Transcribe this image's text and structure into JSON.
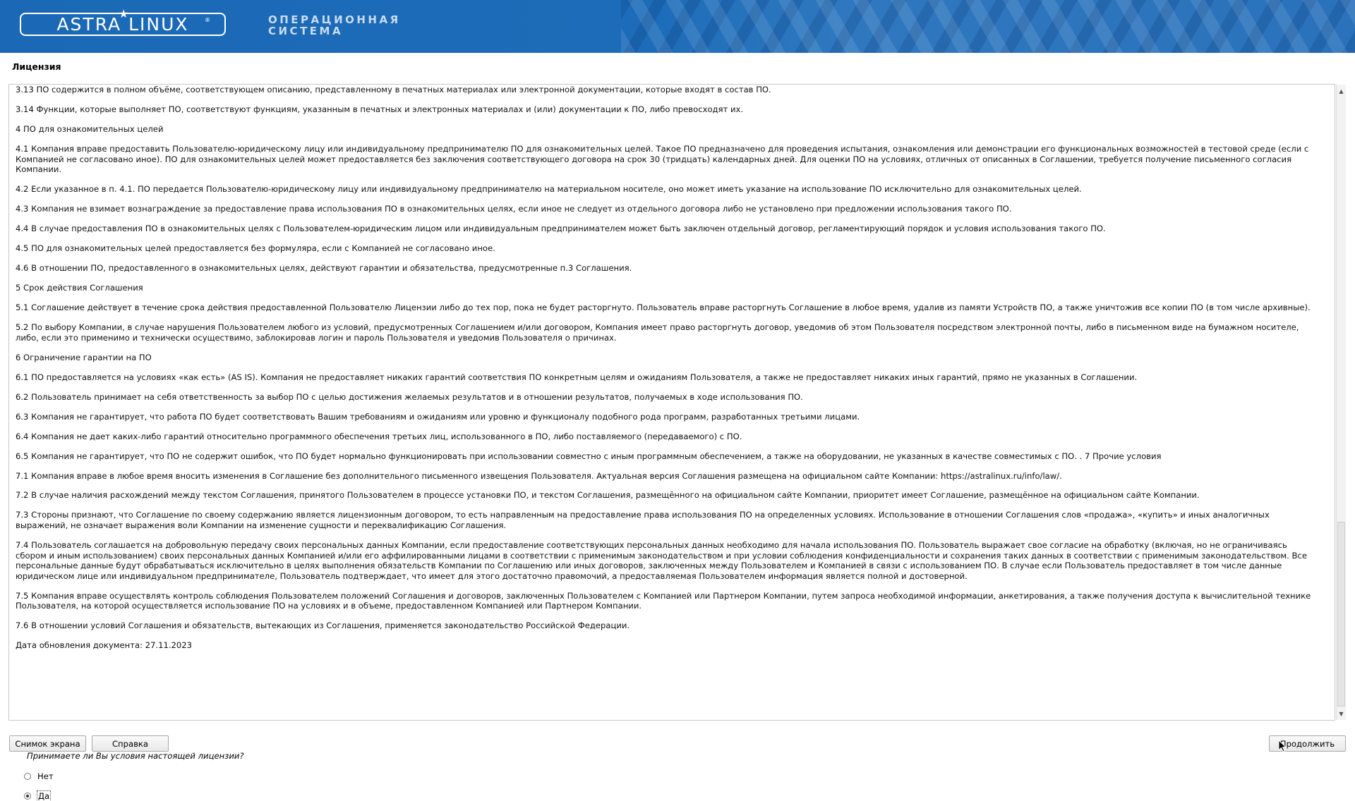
{
  "header": {
    "logo_text": "ASTRA LINUX",
    "logo_registered": "®",
    "subtitle_line1": "ОПЕРАЦИОННАЯ",
    "subtitle_line2": "СИСТЕМА",
    "colors": {
      "banner": "#1b69b6",
      "subtitle": "#c9dcf1"
    }
  },
  "section_title": "Лицензия",
  "license_paragraphs": [
    "3.13 ПО содержится в полном объёме, соответствующем описанию, представленному в печатных материалах или электронной документации, которые входят в состав ПО.",
    "3.14 Функции, которые выполняет ПО, соответствуют функциям, указанным в печатных и электронных материалах и (или) документации к ПО, либо превосходят их.",
    "4 ПО для ознакомительных целей",
    "4.1 Компания вправе предоставить Пользователю-юридическому лицу или индивидуальному предпринимателю ПО для ознакомительных целей. Такое ПО предназначено для проведения испытания, ознакомления или демонстрации его функциональных возможностей в тестовой среде (если с Компанией не согласовано иное). ПО для ознакомительных целей может предоставляется без заключения соответствующего договора на срок 30 (тридцать) календарных дней. Для оценки ПО на условиях, отличных от описанных в Соглашении, требуется получение письменного согласия Компании.",
    "4.2 Если указанное в п. 4.1. ПО передается Пользователю-юридическому лицу или индивидуальному предпринимателю на материальном носителе, оно может иметь указание на использование ПО исключительно для ознакомительных целей.",
    "4.3 Компания не взимает вознаграждение за предоставление права использования ПО в ознакомительных целях, если иное не следует из отдельного договора либо не установлено при предложении использования такого ПО.",
    "4.4 В случае предоставления ПО в ознакомительных целях с Пользователем-юридическим лицом или индивидуальным предпринимателем может быть заключен отдельный договор, регламентирующий порядок и условия использования такого ПО.",
    "4.5 ПО для ознакомительных целей предоставляется без формуляра, если с Компанией не согласовано иное.",
    "4.6 В отношении ПО, предоставленного в ознакомительных целях, действуют гарантии и обязательства, предусмотренные п.3 Соглашения.",
    "5 Срок действия Соглашения",
    "5.1 Соглашение действует в течение срока действия предоставленной Пользователю Лицензии либо до тех пор, пока не будет расторгнуто. Пользователь вправе расторгнуть Соглашение в любое время, удалив из памяти Устройств ПО, а также уничтожив все копии ПО (в том числе архивные).",
    "5.2 По выбору Компании, в случае нарушения Пользователем любого из условий, предусмотренных Соглашением и/или договором, Компания имеет право расторгнуть договор, уведомив об этом Пользователя посредством электронной почты, либо в письменном виде на бумажном носителе, либо, если это применимо и технически осуществимо, заблокировав логин и пароль Пользователя и уведомив Пользователя о причинах.",
    "6 Ограничение гарантии на ПО",
    "6.1 ПО предоставляется на условиях «как есть» (AS IS). Компания не предоставляет никаких гарантий соответствия ПО конкретным целям и ожиданиям Пользователя, а также не предоставляет никаких иных гарантий, прямо не указанных в Соглашении.",
    "6.2 Пользователь принимает на себя ответственность за выбор ПО с целью достижения желаемых результатов и в отношении результатов, получаемых в ходе использования ПО.",
    "6.3 Компания не гарантирует, что работа ПО будет соответствовать Вашим требованиям и ожиданиям или уровню и функционалу подобного рода программ, разработанных третьими лицами.",
    "6.4 Компания не дает каких-либо гарантий относительно программного обеспечения третьих лиц, использованного в ПО, либо поставляемого (передаваемого) с ПО.",
    "6.5 Компания не гарантирует, что ПО не содержит ошибок, что ПО будет нормально функционировать при использовании совместно с иным программным обеспечением, а также на оборудовании, не указанных в качестве совместимых с ПО. .  7 Прочие условия",
    "7.1 Компания вправе в любое время вносить изменения в Соглашение без дополнительного письменного извещения Пользователя. Актуальная версия Соглашения размещена на официальном сайте Компании: https://astralinux.ru/info/law/.",
    "7.2 В случае наличия расхождений между текстом Соглашения, принятого Пользователем в процессе установки ПО, и текстом Соглашения, размещённого на официальном сайте Компании, приоритет имеет Соглашение, размещённое на официальном сайте Компании.",
    "7.3 Стороны признают, что Соглашение по своему содержанию является лицензионным договором, то есть направленным на предоставление права использования ПО на определенных условиях. Использование в отношении Соглашения слов «продажа», «купить» и иных аналогичных выражений, не означает выражения воли Компании на изменение сущности и переквалификацию Соглашения.",
    "7.4 Пользователь соглашается на добровольную передачу своих персональных данных Компании, если предоставление соответствующих персональных данных необходимо для начала использования ПО. Пользователь выражает свое согласие на обработку (включая, но не ограничиваясь сбором и иным использованием) своих персональных данных Компанией и/или его аффилированными лицами в соответствии с применимым законодательством и при условии соблюдения конфиденциальности и сохранения таких данных в соответствии с применимым законодательством. Все персональные данные будут обрабатываться исключительно в целях выполнения обязательств Компании по Соглашению или иных договоров, заключенных между Пользователем и Компанией в связи с использованием ПО. В случае если Пользователь предоставляет в том числе данные юридическом лице или индивидуальном предпринимателе, Пользователь подтверждает, что имеет для этого достаточно правомочий, а предоставляемая Пользователем информация является полной и достоверной.",
    "7.5 Компания вправе осуществлять контроль соблюдения Пользователем положений Соглашения и договоров, заключенных Пользователем с Компанией или Партнером Компании, путем запроса необходимой информации, анкетирования, а также получения доступа к вычислительной технике Пользователя, на которой осуществляется использование ПО на условиях и в объеме, предоставленном Компанией или Партнером Компании.",
    "7.6 В отношении условий Соглашения и обязательств, вытекающих из Соглашения, применяется законодательство Российской Федерации.",
    "Дата обновления документа: 27.11.2023"
  ],
  "question": "Принимаете ли Вы условия настоящей лицензии?",
  "options": [
    {
      "label": "Нет",
      "selected": false
    },
    {
      "label": "Да",
      "selected": true
    }
  ],
  "buttons": {
    "screenshot": "Снимок экрана",
    "help": "Справка",
    "continue": "Продолжить"
  }
}
